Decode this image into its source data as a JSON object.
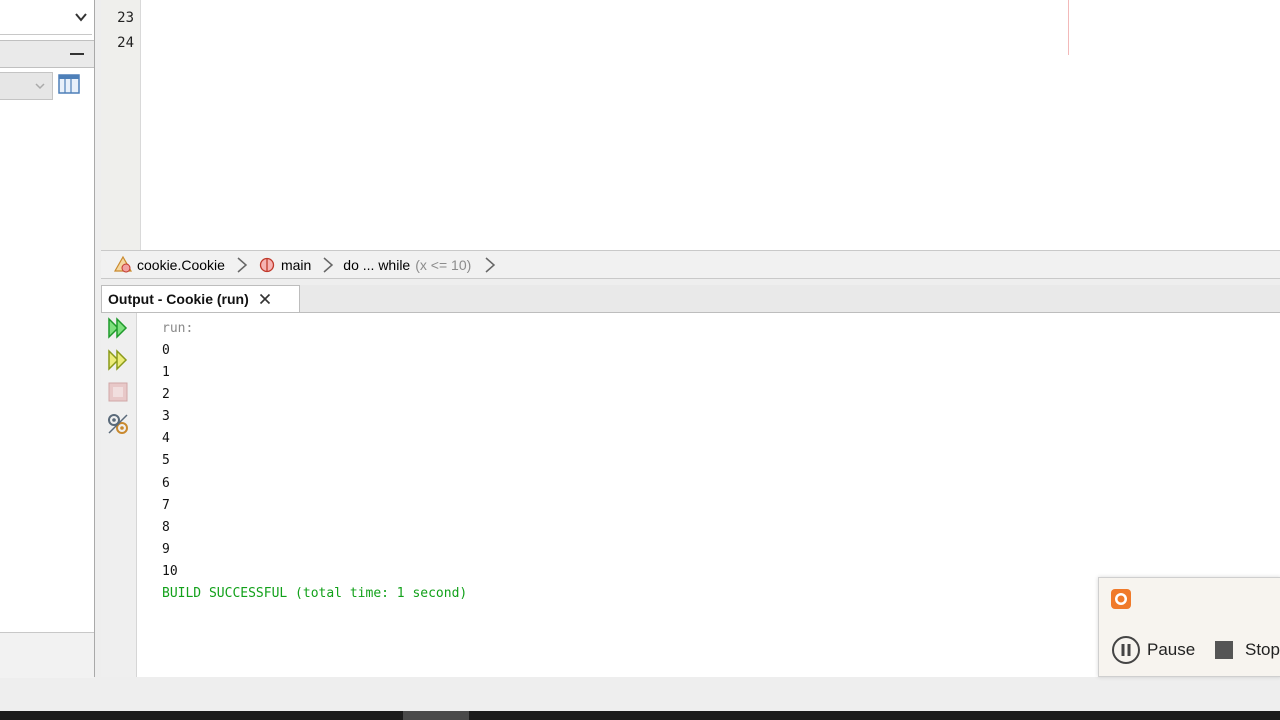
{
  "editor": {
    "line_numbers": [
      "23",
      "24"
    ]
  },
  "breadcrumb": {
    "class_label": "cookie.Cookie",
    "method_label": "main",
    "loop_label": "do ... while",
    "loop_condition": "(x <= 10)"
  },
  "output": {
    "tab_title": "Output - Cookie (run)",
    "lines": {
      "run": "run:",
      "l0": "0",
      "l1": "1",
      "l2": "2",
      "l3": "3",
      "l4": "4",
      "l5": "5",
      "l6": "6",
      "l7": "7",
      "l8": "8",
      "l9": "9",
      "l10": "10",
      "success": "BUILD SUCCESSFUL (total time: 1 second)"
    },
    "toolbar_icons": [
      "rerun-icon",
      "rerun-with-params-icon",
      "stop-icon",
      "settings-icon"
    ]
  },
  "recorder": {
    "pause_label": "Pause",
    "stop_label": "Stop"
  },
  "colors": {
    "success_green": "#12a11a",
    "recorder_orange": "#f07a2a",
    "run_green": "#2dbf3a"
  }
}
